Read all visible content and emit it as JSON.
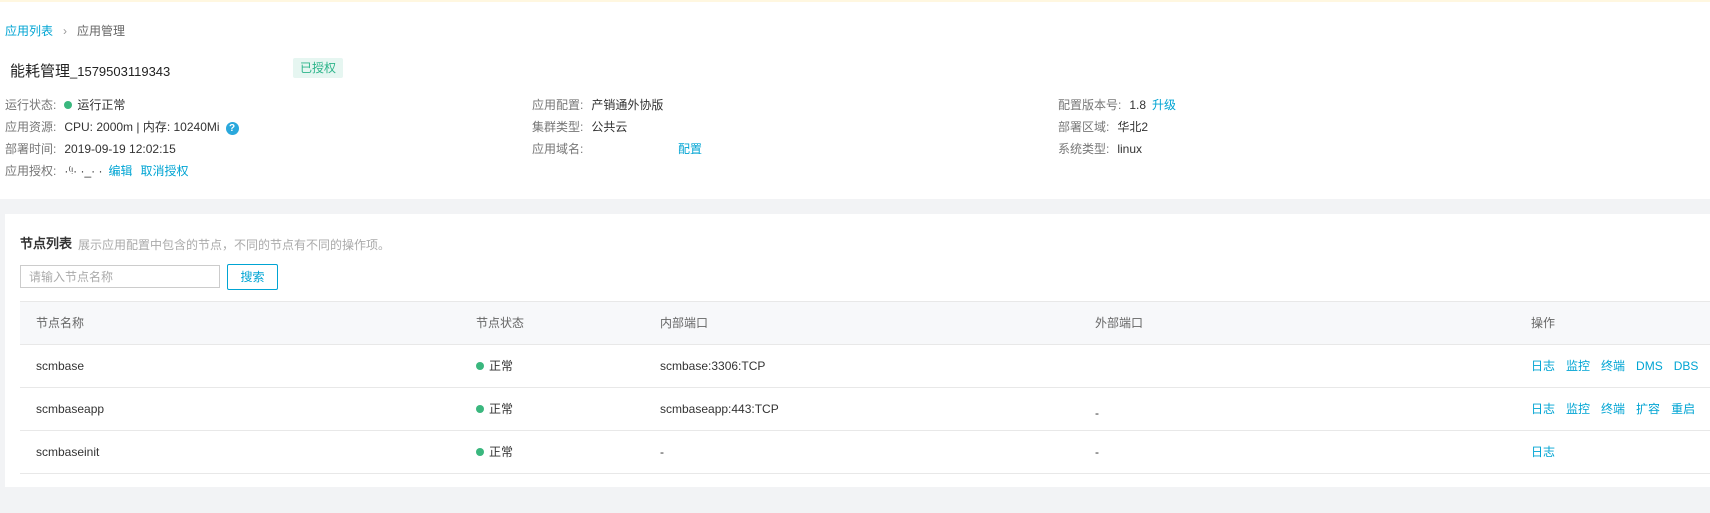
{
  "breadcrumb": {
    "root": "应用列表",
    "current": "应用管理"
  },
  "app": {
    "name": "能耗管理",
    "id": "_1579503119343",
    "badge": "已授权"
  },
  "info": {
    "run_status": {
      "key": "运行状态:",
      "value": "运行正常"
    },
    "resource": {
      "key": "应用资源:",
      "value": "CPU: 2000m | 内存: 10240Mi",
      "help": "?"
    },
    "deploy_time": {
      "key": "部署时间:",
      "value": "2019-09-19 12:02:15"
    },
    "license": {
      "key": "应用授权:",
      "value": "·⁽ᵎ· ·_·  ·",
      "edit": "编辑",
      "cancel": "取消授权"
    },
    "config": {
      "key": "应用配置:",
      "value": "产销通外协版"
    },
    "cluster": {
      "key": "集群类型:",
      "value": "公共云"
    },
    "domain": {
      "key": "应用域名:",
      "action": "配置"
    },
    "version": {
      "key": "配置版本号:",
      "value": "1.8",
      "upgrade": "升级"
    },
    "region": {
      "key": "部署区域:",
      "value": "华北2"
    },
    "os": {
      "key": "系统类型:",
      "value": "linux"
    }
  },
  "nodes": {
    "title": "节点列表",
    "desc": "展示应用配置中包含的节点，不同的节点有不同的操作项。",
    "search": {
      "placeholder": "请输入节点名称",
      "button": "搜索"
    },
    "columns": [
      "节点名称",
      "节点状态",
      "内部端口",
      "外部端口",
      "操作"
    ],
    "rows": [
      {
        "name": "scmbase",
        "status": "正常",
        "internal": "scmbase:3306:TCP",
        "external": "",
        "ops": [
          "日志",
          "监控",
          "终端",
          "DMS",
          "DBS"
        ]
      },
      {
        "name": "scmbaseapp",
        "status": "正常",
        "internal": "scmbaseapp:443:TCP",
        "external": "-",
        "ops": [
          "日志",
          "监控",
          "终端",
          "扩容",
          "重启"
        ]
      },
      {
        "name": "scmbaseinit",
        "status": "正常",
        "internal": "-",
        "external": "-",
        "ops": [
          "日志"
        ]
      }
    ]
  },
  "colors": {
    "accent": "#00a4d3",
    "ok": "#3ab77e",
    "badge_bg": "#e6f6f1",
    "badge_fg": "#2cb48a"
  }
}
